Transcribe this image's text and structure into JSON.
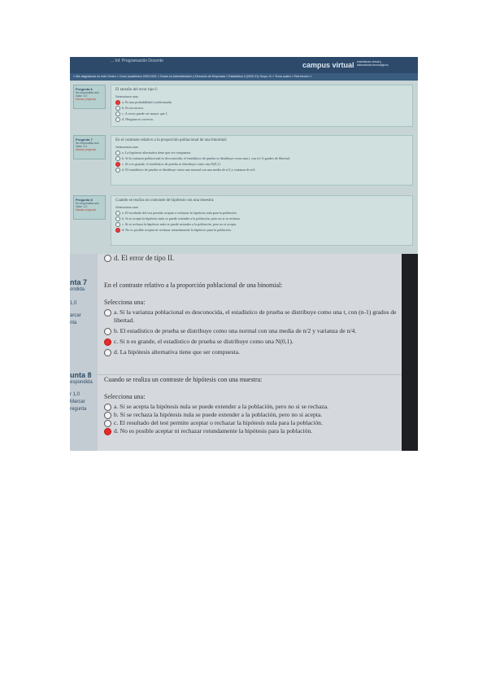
{
  "photo1": {
    "header": {
      "title": "... Inf. Programación Docente",
      "brand": "campus virtual",
      "brand_sub": "enseñanza virtual y laboratorios tecnológicos",
      "breadcrumb": "» Mis asignaturas en este Centro » Curso académico 2020-2021 » Grado en Administración y Dirección de Empresas » Estadística II (2020-21) Grupo 11 » Tema cuatro » Test tercero »"
    },
    "questions": [
      {
        "number": "Pregunta 6",
        "status": "No respondida aún",
        "points": "Valor: 1,0",
        "flag": "Marcar pregunta",
        "text": "El tamaño del error tipo I:",
        "select_label": "Selecciona una:",
        "options": [
          {
            "label": "a. Es una probabilidad condicionada.",
            "selected": true
          },
          {
            "label": "b. Es un suceso.",
            "selected": false
          },
          {
            "label": "c. A veces puede ser mayor que 1.",
            "selected": false
          },
          {
            "label": "d. Ninguna es correcta.",
            "selected": false
          }
        ]
      },
      {
        "number": "Pregunta 7",
        "status": "No respondida aún",
        "points": "Valor: 1,0",
        "flag": "Marcar pregunta",
        "text": "En el contraste relativo a la proporción poblacional de una binomial:",
        "select_label": "Selecciona una:",
        "options": [
          {
            "label": "a. La hipótesis alternativa tiene que ser compuesta.",
            "selected": false
          },
          {
            "label": "b. Si la varianza poblacional es desconocida, el estadístico de prueba se distribuye como una t, con (n-1) grados de libertad.",
            "selected": false
          },
          {
            "label": "c. Si n es grande, el estadístico de prueba se distribuye como una N(0,1).",
            "selected": true
          },
          {
            "label": "d. El estadístico de prueba se distribuye como una normal con una media de n/2 y varianza de n/4.",
            "selected": false
          }
        ]
      },
      {
        "number": "Pregunta 8",
        "status": "No respondida aún",
        "points": "Valor: 1,0",
        "flag": "Marcar pregunta",
        "text": "Cuando se realiza un contraste de hipótesis con una muestra:",
        "select_label": "Selecciona una:",
        "options": [
          {
            "label": "a. El resultado del test permite aceptar o rechazar la hipótesis nula para la población.",
            "selected": false
          },
          {
            "label": "b. Si se acepta la hipótesis nula se puede extender a la población, pero no si se rechaza.",
            "selected": false
          },
          {
            "label": "c. Si se rechaza la hipótesis nula se puede extender a la población, pero no si acepta.",
            "selected": false
          },
          {
            "label": "d. No es posible aceptar ni rechazar rotundamente la hipótesis para la población.",
            "selected": true
          }
        ]
      }
    ]
  },
  "photo2": {
    "prev_option": "d. El error de tipo II.",
    "q7": {
      "side_number": "nta 7",
      "side_status": "ondida",
      "side_points": "1,0",
      "side_flag_1": "arcar",
      "side_flag_2": "nta",
      "text": "En el contraste relativo a la proporción poblacional de una binomial:",
      "select_label": "Selecciona una:",
      "options": [
        {
          "label": "a. Si la varianza poblacional es desconocida, el estadístico de prueba se distribuye como una t, con (n-1) grados de libertad.",
          "selected": false
        },
        {
          "label": "b. El estadístico de prueba se distribuye como una normal con una media de n/2 y varianza de n/4.",
          "selected": false
        },
        {
          "label": "c. Si n es grande, el estadístico de prueba se distribuye como una N(0,1).",
          "selected": true
        },
        {
          "label": "d. La hipótesis alternativa tiene que ser compuesta.",
          "selected": false
        }
      ]
    },
    "q8": {
      "side_number": "unta 8",
      "side_status": "espondida",
      "side_points": "r 1,0",
      "side_flag_1": "Marcar",
      "side_flag_2": "regunta",
      "text": "Cuando se realiza un contraste de hipótesis con una muestra:",
      "select_label": "Selecciona una:",
      "options": [
        {
          "label": "a. Si se acepta la hipótesis nula se puede extender a la población, pero no si se rechaza.",
          "selected": false
        },
        {
          "label": "b. Si se rechaza la hipótesis nula se puede extender a la población, pero no si acepta.",
          "selected": false
        },
        {
          "label": "c. El resultado del test permite aceptar o rechazar la hipótesis nula para la población.",
          "selected": false
        },
        {
          "label": "d. No es posible aceptar ni rechazar rotundamente la hipótesis para la población.",
          "selected": true
        }
      ]
    }
  }
}
